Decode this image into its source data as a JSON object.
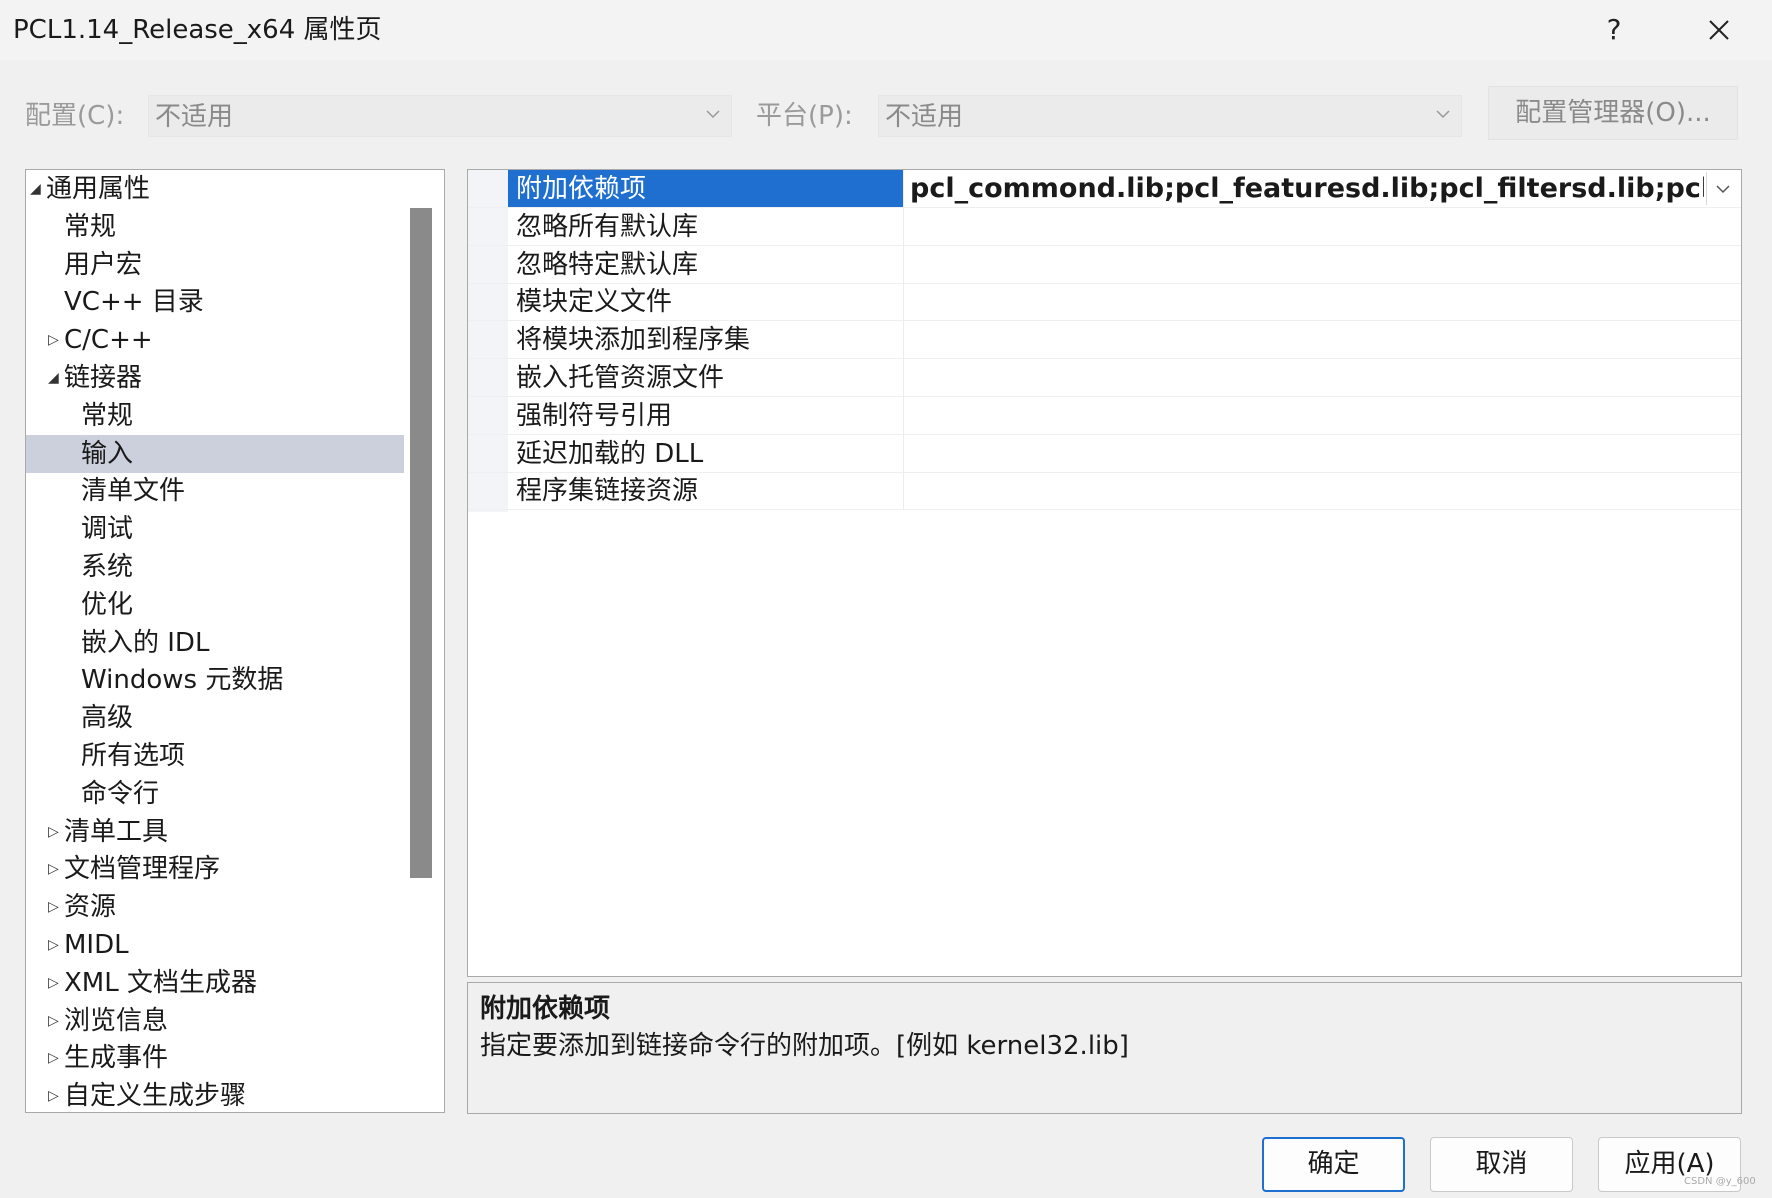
{
  "window": {
    "title": "PCL1.14_Release_x64 属性页",
    "help": "?",
    "close_icon": "close-icon"
  },
  "config": {
    "config_label": "配置(C):",
    "config_value": "不适用",
    "platform_label": "平台(P):",
    "platform_value": "不适用",
    "manager_button": "配置管理器(O)..."
  },
  "tree": {
    "items": [
      {
        "label": "通用属性",
        "expander": "◢"
      },
      {
        "label": "常规",
        "expander": ""
      },
      {
        "label": "用户宏",
        "expander": ""
      },
      {
        "label": "VC++ 目录",
        "expander": ""
      },
      {
        "label": "C/C++",
        "expander": "▷"
      },
      {
        "label": "链接器",
        "expander": "◢"
      },
      {
        "label": "常规",
        "expander": ""
      },
      {
        "label": "输入",
        "expander": "",
        "selected": true
      },
      {
        "label": "清单文件",
        "expander": ""
      },
      {
        "label": "调试",
        "expander": ""
      },
      {
        "label": "系统",
        "expander": ""
      },
      {
        "label": "优化",
        "expander": ""
      },
      {
        "label": "嵌入的 IDL",
        "expander": ""
      },
      {
        "label": "Windows 元数据",
        "expander": ""
      },
      {
        "label": "高级",
        "expander": ""
      },
      {
        "label": "所有选项",
        "expander": ""
      },
      {
        "label": "命令行",
        "expander": ""
      },
      {
        "label": "清单工具",
        "expander": "▷"
      },
      {
        "label": "文档管理程序",
        "expander": "▷"
      },
      {
        "label": "资源",
        "expander": "▷"
      },
      {
        "label": "MIDL",
        "expander": "▷"
      },
      {
        "label": "XML 文档生成器",
        "expander": "▷"
      },
      {
        "label": "浏览信息",
        "expander": "▷"
      },
      {
        "label": "生成事件",
        "expander": "▷"
      },
      {
        "label": "自定义生成步骤",
        "expander": "▷"
      }
    ]
  },
  "grid": {
    "rows": [
      {
        "name": "附加依赖项",
        "value": "pcl_commond.lib;pcl_featuresd.lib;pcl_filtersd.lib;pcl_iod.lib",
        "selected": true
      },
      {
        "name": "忽略所有默认库",
        "value": ""
      },
      {
        "name": "忽略特定默认库",
        "value": ""
      },
      {
        "name": "模块定义文件",
        "value": ""
      },
      {
        "name": "将模块添加到程序集",
        "value": ""
      },
      {
        "name": "嵌入托管资源文件",
        "value": ""
      },
      {
        "name": "强制符号引用",
        "value": ""
      },
      {
        "name": "延迟加载的 DLL",
        "value": ""
      },
      {
        "name": "程序集链接资源",
        "value": ""
      }
    ]
  },
  "description": {
    "title": "附加依赖项",
    "text": "指定要添加到链接命令行的附加项。[例如 kernel32.lib]"
  },
  "buttons": {
    "ok": "确定",
    "cancel": "取消",
    "apply": "应用(A)"
  },
  "watermark": "CSDN @y_600",
  "colors": {
    "selection_blue": "#1f6fd1",
    "tree_selected": "#ccd0dc"
  }
}
